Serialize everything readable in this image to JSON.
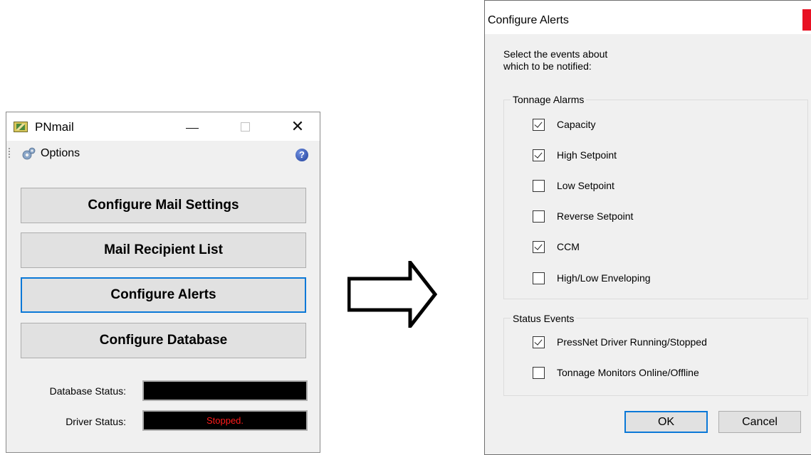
{
  "left_window": {
    "title": "PNmail",
    "menu": {
      "options_label": "Options"
    },
    "buttons": [
      "Configure Mail Settings",
      "Mail Recipient List",
      "Configure Alerts",
      "Configure Database"
    ],
    "status": {
      "database_label": "Database Status:",
      "database_value": "",
      "driver_label": "Driver Status:",
      "driver_value": "Stopped."
    }
  },
  "right_window": {
    "title": "Configure Alerts",
    "close_glyph": "x",
    "intro_line1": "Select the events about",
    "intro_line2": "which to be notified:",
    "tonnage_group": {
      "legend": "Tonnage Alarms",
      "items": [
        {
          "label": "Capacity",
          "checked": true
        },
        {
          "label": "High Setpoint",
          "checked": true
        },
        {
          "label": "Low Setpoint",
          "checked": false
        },
        {
          "label": "Reverse Setpoint",
          "checked": false
        },
        {
          "label": "CCM",
          "checked": true
        },
        {
          "label": "High/Low Enveloping",
          "checked": false
        }
      ]
    },
    "status_group": {
      "legend": "Status Events",
      "items": [
        {
          "label": "PressNet Driver Running/Stopped",
          "checked": true
        },
        {
          "label": "Tonnage Monitors Online/Offline",
          "checked": false
        }
      ]
    },
    "ok_label": "OK",
    "cancel_label": "Cancel"
  },
  "colors": {
    "focus_blue": "#0a78d7",
    "status_text": "#ff1b1b",
    "close_red": "#e81123"
  }
}
